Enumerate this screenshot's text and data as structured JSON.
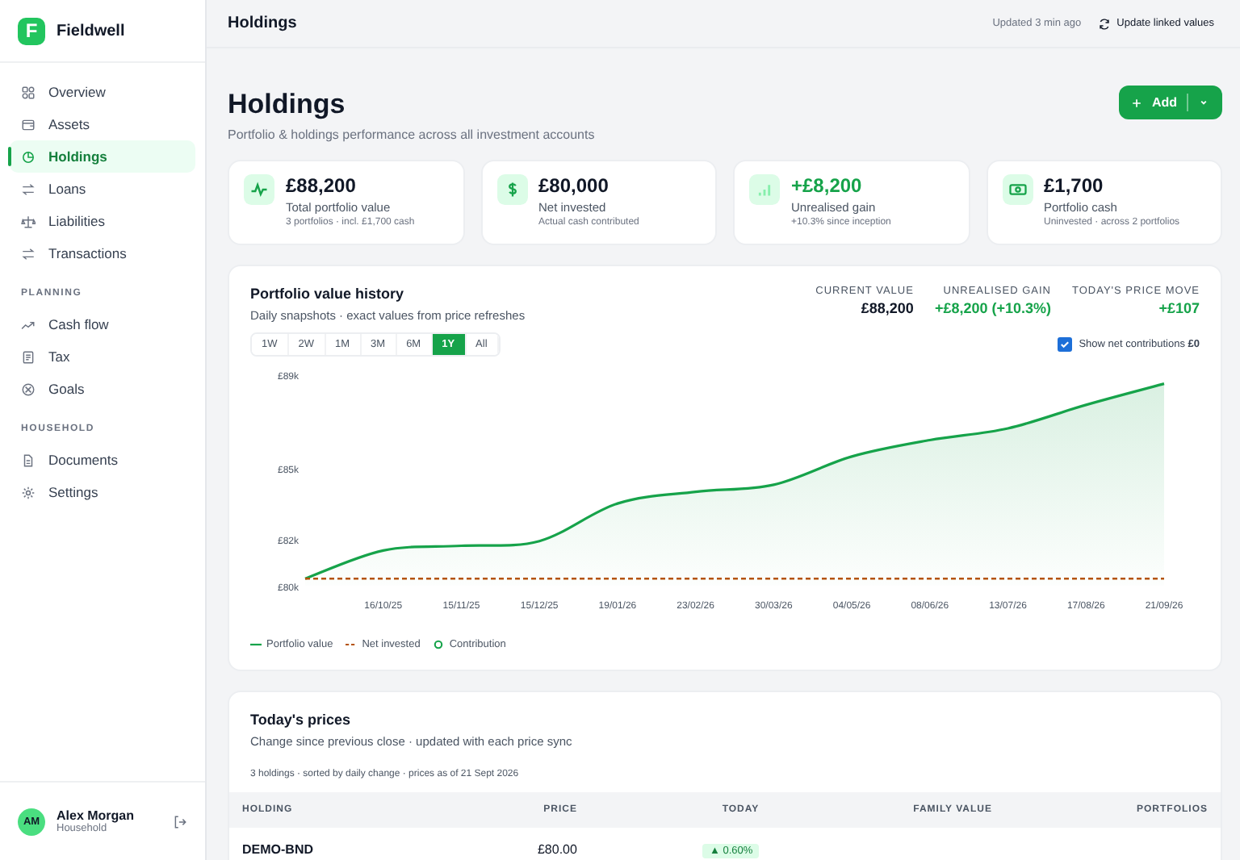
{
  "brand": {
    "letter": "F",
    "name": "Fieldwell"
  },
  "nav_sections": [
    {
      "items": [
        {
          "label": "Overview",
          "selected": false
        },
        {
          "label": "Assets",
          "selected": false
        },
        {
          "label": "Holdings",
          "selected": true
        },
        {
          "label": "Loans",
          "selected": false
        },
        {
          "label": "Liabilities",
          "selected": false
        },
        {
          "label": "Transactions",
          "selected": false
        }
      ]
    },
    {
      "heading": "PLANNING",
      "items": [
        {
          "label": "Cash flow",
          "selected": false
        },
        {
          "label": "Tax",
          "selected": false
        },
        {
          "label": "Goals",
          "selected": false
        }
      ]
    },
    {
      "heading": "HOUSEHOLD",
      "items": [
        {
          "label": "Documents",
          "selected": false
        },
        {
          "label": "Settings",
          "selected": false
        }
      ]
    }
  ],
  "user": {
    "initials": "AM",
    "name": "Alex Morgan",
    "role": "Household"
  },
  "top_bar": {
    "title": "Holdings",
    "updated": "Updated 3 min ago",
    "action": "Update linked values"
  },
  "page": {
    "title": "Holdings",
    "subtitle": "Portfolio & holdings performance across all investment accounts",
    "add_button": "Add"
  },
  "stats": [
    {
      "value": "£88,200",
      "color": "#111827",
      "label": "Total portfolio value",
      "note": "3 portfolios · incl. £1,700 cash"
    },
    {
      "value": "£80,000",
      "color": "#111827",
      "label": "Net invested",
      "note": "Actual cash contributed"
    },
    {
      "value": "+£8,200",
      "color": "#16a34a",
      "label": "Unrealised gain",
      "note": "+10.3% since inception"
    },
    {
      "value": "£1,700",
      "color": "#111827",
      "label": "Portfolio cash",
      "note": "Uninvested · across 2 portfolios"
    }
  ],
  "history": {
    "title": "Portfolio value history",
    "subtitle": "Daily snapshots · exact values from price refreshes",
    "summary": [
      {
        "label": "CURRENT VALUE",
        "value": "£88,200",
        "color": "#111827"
      },
      {
        "label": "UNREALISED GAIN",
        "value": "+£8,200 (+10.3%)",
        "color": "#16a34a"
      },
      {
        "label": "TODAY'S PRICE MOVE",
        "value": "+£107",
        "color": "#16a34a"
      }
    ],
    "ranges": [
      {
        "label": "1W",
        "selected": false
      },
      {
        "label": "2W",
        "selected": false
      },
      {
        "label": "1M",
        "selected": false
      },
      {
        "label": "3M",
        "selected": false
      },
      {
        "label": "6M",
        "selected": false
      },
      {
        "label": "1Y",
        "selected": true
      },
      {
        "label": "All",
        "selected": false
      }
    ],
    "contributions_toggle": {
      "label": "Show net contributions **£0**",
      "checked": true
    },
    "chart_data": {
      "type": "area",
      "categories": [
        null,
        "16/10/25",
        "15/11/25",
        "15/12/25",
        "19/01/26",
        "23/02/26",
        "30/03/26",
        "04/05/26",
        "08/06/26",
        "13/07/26",
        "17/08/26",
        "21/09/26"
      ],
      "ylim": [
        80000,
        89000
      ],
      "yticks": [
        {
          "value": 80000,
          "label": "£80k"
        },
        {
          "value": 82000,
          "label": "£82k"
        },
        {
          "value": 85000,
          "label": "£85k"
        },
        {
          "value": 89000,
          "label": "£89k"
        }
      ],
      "series": [
        {
          "name": "Portfolio value",
          "color": "#16a34a",
          "values": [
            80300,
            81500,
            81700,
            81900,
            83500,
            84000,
            84300,
            85500,
            86200,
            86700,
            87700,
            88600
          ]
        },
        {
          "name": "Net invested",
          "color": "#b45309",
          "type": "line",
          "line_style": "dashed",
          "values": [
            80300,
            80300,
            80300,
            80300,
            80300,
            80300,
            80300,
            80300,
            80300,
            80300,
            80300,
            80300
          ]
        },
        {
          "name": "Contribution",
          "color": "#16a34a",
          "type": "scatter",
          "values": [
            null,
            null,
            null,
            null,
            null,
            null,
            null,
            null,
            null,
            null,
            null,
            null
          ]
        }
      ]
    }
  },
  "prices": {
    "title": "Today's prices",
    "subtitle": "Change since previous close · updated with each price sync",
    "meta": "3 holdings · sorted by daily change · prices as of 21 Sept 2026",
    "columns": [
      "HOLDING",
      "PRICE",
      "TODAY",
      "FAMILY VALUE",
      "PORTFOLIOS"
    ],
    "rows": [
      {
        "holding": "DEMO-BND",
        "price": "£80.00",
        "today": "▲ 0.60%",
        "color": "#15803d"
      }
    ]
  }
}
